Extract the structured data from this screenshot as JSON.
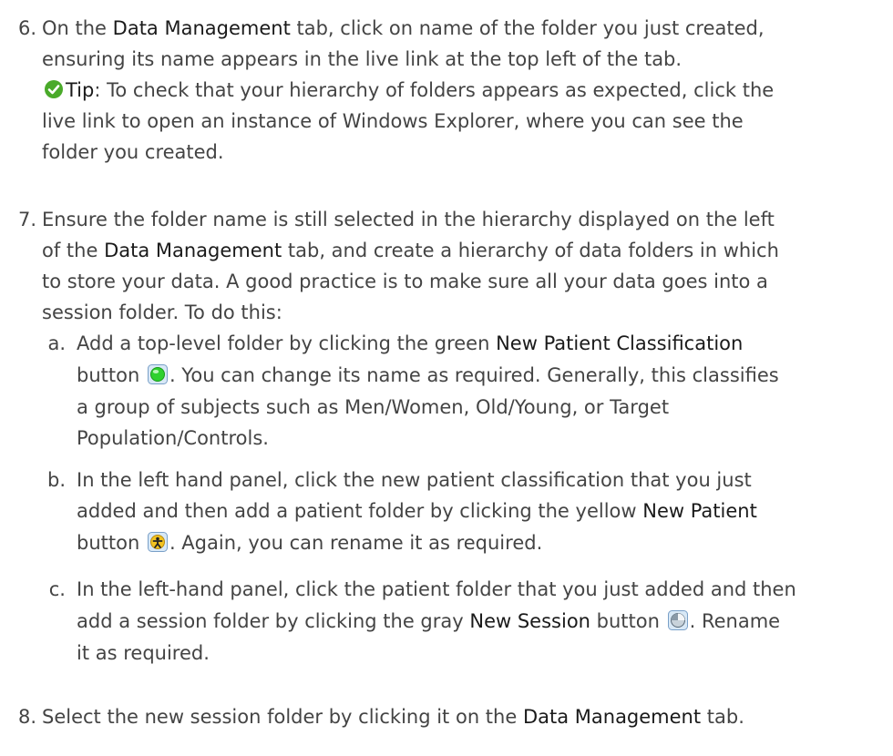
{
  "steps": [
    {
      "number": "6.",
      "lines": [
        {
          "a": "On the ",
          "ui": "Data Management",
          "b": " tab, click on name of the folder you just created,"
        },
        {
          "a": "ensuring its name appears in the live link at the top left of the tab."
        }
      ],
      "tip": {
        "icon": "checkmark-icon",
        "label": "Tip",
        "lines": [
          ": To check that your hierarchy of folders appears as expected, click the",
          "live link to open an instance of Windows Explorer, where you can see the",
          "folder you created."
        ]
      }
    },
    {
      "number": "7.",
      "lines": [
        {
          "a": "Ensure the folder name is still selected in the hierarchy displayed on the left"
        },
        {
          "a": "of the ",
          "ui": "Data Management",
          "b": " tab, and create a hierarchy of data folders in which"
        },
        {
          "a": "to store your data. A good practice is to make sure all your data goes into a"
        },
        {
          "a": "session folder. To do this:"
        }
      ],
      "substeps": [
        {
          "letter": "a.",
          "l1a": "Add a top-level folder by clicking the green ",
          "l1ui": "New Patient Classification",
          "l2a": "button ",
          "icon": "green-circle-icon",
          "l2b": ". You can change its name as required. Generally, this classifies",
          "l3": "a group of subjects such as Men/Women, Old/Young, or Target",
          "l4": "Population/Controls."
        },
        {
          "letter": "b.",
          "l1": "In the left hand panel, click the new patient classification that you just",
          "l2a": "added and then add a patient folder by clicking the yellow ",
          "l2ui": "New Patient",
          "l3a": "button ",
          "icon": "patient-icon",
          "l3b": ". Again, you can rename it as required."
        },
        {
          "letter": "c.",
          "l1": "In the left-hand panel, click the patient folder that you just added and then",
          "l2a": "add a session folder by clicking the gray ",
          "l2ui": "New Session",
          "l2b": " button ",
          "icon": "session-icon",
          "l2c": ". Rename",
          "l3": "it as required."
        }
      ]
    },
    {
      "number": "8.",
      "a": "Select the new session folder by clicking it on the ",
      "ui": "Data Management",
      "b": " tab."
    }
  ],
  "colors": {
    "text": "#444444",
    "ui_term": "#1a1a1a",
    "tip_green": "#4aaa2a",
    "new_patient_classification": "#2fd12f",
    "new_patient": "#f3c320",
    "new_session": "#8a9aa8"
  }
}
